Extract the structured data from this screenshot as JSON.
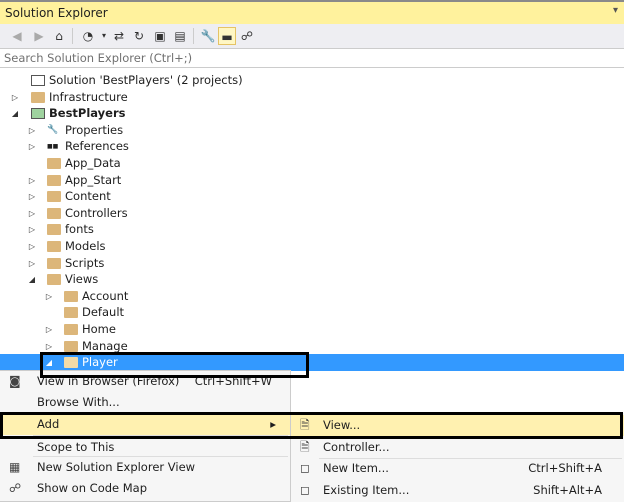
{
  "title": "Solution Explorer",
  "search_placeholder": "Search Solution Explorer (Ctrl+;)",
  "tree": [
    {
      "label": "Solution 'BestPlayers' (2 projects)",
      "level": 0,
      "expander": "",
      "icon": "solution"
    },
    {
      "label": "Infrastructure",
      "level": 0,
      "expander": "collapsed",
      "icon": "folder"
    },
    {
      "label": "BestPlayers",
      "level": 0,
      "expander": "expanded",
      "icon": "web-project",
      "bold": true
    },
    {
      "label": "Properties",
      "level": 1,
      "expander": "collapsed",
      "icon": "wrench"
    },
    {
      "label": "References",
      "level": 1,
      "expander": "collapsed",
      "icon": "references"
    },
    {
      "label": "App_Data",
      "level": 1,
      "expander": "",
      "icon": "folder"
    },
    {
      "label": "App_Start",
      "level": 1,
      "expander": "collapsed",
      "icon": "folder"
    },
    {
      "label": "Content",
      "level": 1,
      "expander": "collapsed",
      "icon": "folder"
    },
    {
      "label": "Controllers",
      "level": 1,
      "expander": "collapsed",
      "icon": "folder"
    },
    {
      "label": "fonts",
      "level": 1,
      "expander": "collapsed",
      "icon": "folder"
    },
    {
      "label": "Models",
      "level": 1,
      "expander": "collapsed",
      "icon": "folder"
    },
    {
      "label": "Scripts",
      "level": 1,
      "expander": "collapsed",
      "icon": "folder"
    },
    {
      "label": "Views",
      "level": 1,
      "expander": "expanded",
      "icon": "folder"
    },
    {
      "label": "Account",
      "level": 2,
      "expander": "collapsed",
      "icon": "folder"
    },
    {
      "label": "Default",
      "level": 2,
      "expander": "",
      "icon": "folder"
    },
    {
      "label": "Home",
      "level": 2,
      "expander": "collapsed",
      "icon": "folder"
    },
    {
      "label": "Manage",
      "level": 2,
      "expander": "collapsed",
      "icon": "folder"
    },
    {
      "label": "Player",
      "level": 2,
      "expander": "expanded",
      "icon": "folder",
      "selected": true
    }
  ],
  "context_menu": [
    {
      "label": "View in Browser (Firefox)",
      "shortcut": "Ctrl+Shift+W",
      "icon": "browser-icon"
    },
    {
      "label": "Browse With...",
      "shortcut": "",
      "icon": ""
    },
    {
      "label": "Add",
      "shortcut": "",
      "icon": "",
      "submenu": true,
      "highlighted": true
    },
    {
      "label": "Scope to This",
      "shortcut": "",
      "icon": ""
    },
    {
      "label": "New Solution Explorer View",
      "shortcut": "",
      "icon": "new-view-icon"
    },
    {
      "label": "Show on Code Map",
      "shortcut": "",
      "icon": "code-map-icon"
    }
  ],
  "submenu": [
    {
      "label": "View...",
      "shortcut": "",
      "highlighted": true
    },
    {
      "label": "Controller...",
      "shortcut": ""
    },
    {
      "label": "New Item...",
      "shortcut": "Ctrl+Shift+A"
    },
    {
      "label": "Existing Item...",
      "shortcut": "Shift+Alt+A"
    }
  ],
  "colors": {
    "title_bg": "#fff29d",
    "selection": "#3399ff",
    "menu_highlight": "#fff1b0"
  }
}
